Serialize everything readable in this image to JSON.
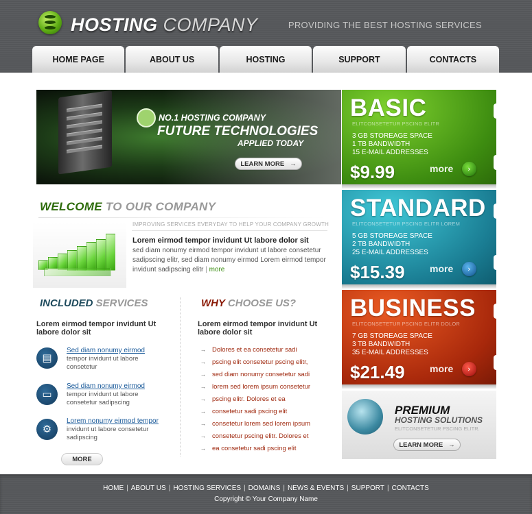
{
  "header": {
    "logo_word1": "HOSTING",
    "logo_word2": "COMPANY",
    "tagline": "PROVIDING THE BEST HOSTING SERVICES"
  },
  "nav": {
    "items": [
      {
        "label": "HOME PAGE"
      },
      {
        "label": "ABOUT US"
      },
      {
        "label": "HOSTING"
      },
      {
        "label": "SUPPORT"
      },
      {
        "label": "CONTACTS"
      }
    ]
  },
  "banner": {
    "subtitle": "NO.1 HOSTING COMPANY",
    "title": "FUTURE TECHNOLOGIES",
    "tagline": "APPLIED TODAY",
    "button": "LEARN MORE"
  },
  "plans": [
    {
      "name": "BASIC",
      "sub": "ELITCONSETETUR PSCING ELITR",
      "features": [
        "3 GB STOREAGE SPACE",
        "1 TB BANDWIDTH",
        "15 E-MAIL ADDRESSES"
      ],
      "price": "$9.99",
      "more": "more",
      "color": "#4ea015"
    },
    {
      "name": "STANDARD",
      "sub": "ELITCONSETETUR PSCING ELITR LOREM",
      "features": [
        "5 GB STOREAGE SPACE",
        "2 TB BANDWIDTH",
        "25 E-MAIL ADDRESSES"
      ],
      "price": "$15.39",
      "more": "more",
      "color": "#1a8fa3"
    },
    {
      "name": "BUSINESS",
      "sub": "ELITCONSETETUR PSCING ELITR DOLOR",
      "features": [
        "7 GB STOREAGE SPACE",
        "3 TB BANDWIDTH",
        "35 E-MAIL ADDRESSES"
      ],
      "price": "$21.49",
      "more": "more",
      "color": "#c13a12"
    }
  ],
  "welcome": {
    "heading_highlight": "WELCOME",
    "heading_rest": " TO OUR COMPANY",
    "tagline": "IMPROVING SERVICES EVERYDAY TO HELP YOUR COMPANY GROWTH",
    "title": "Lorem eirmod tempor invidunt Ut labore dolor sit",
    "body": "sed diam nonumy eirmod tempor invidunt ut labore consetetur sadipscing elitr, sed diam nonumy eirmod Lorem eirmod tempor invidunt sadipscing elitr",
    "more": "more"
  },
  "services": {
    "heading_highlight": "INCLUDED",
    "heading_rest": " SERVICES",
    "title": "Lorem eirmod tempor invidunt Ut labore dolor sit",
    "items": [
      {
        "link": "Sed diam nonumy eirmod",
        "text": "tempor invidunt ut labore consetetur"
      },
      {
        "link": "Sed diam nonumy eirmod",
        "text": "tempor invidunt ut labore consetetur sadipscing"
      },
      {
        "link": "Lorem  nonumy eirmod tempor",
        "text": "invidunt ut labore consetetur sadipscing"
      }
    ],
    "more": "MORE"
  },
  "why": {
    "heading_highlight": "WHY",
    "heading_rest": " CHOOSE US?",
    "title": "Lorem eirmod tempor invidunt Ut labore dolor sit",
    "items": [
      "Dolores et ea consetetur sadi",
      "pscing elit consetetur pscing elitr,",
      "sed diam nonumy consetetur sadi",
      "lorem sed lorem ipsum consetetur",
      "pscing elitr. Dolores et ea",
      "consetetur sadi pscing elit",
      "consetetur lorem sed lorem ipsum",
      "consetetur pscing elitr. Dolores et",
      "ea consetetur sadi pscing elit"
    ]
  },
  "premium": {
    "title": "PREMIUM",
    "subtitle": "HOSTING SOLUTIONS",
    "sub": "ELITCONSETETUR PSCING ELITR.",
    "button": "LEARN MORE"
  },
  "footer": {
    "links": [
      "HOME",
      "ABOUT US",
      "HOSTING SERVICES",
      "DOMAINS",
      "NEWS & EVENTS",
      "SUPPORT",
      "CONTACTS"
    ],
    "separator": "|",
    "copyright": "Copyright © Your Company Name"
  },
  "icons": {
    "logo": "database-icon",
    "arrow": "arrow-right-icon"
  }
}
